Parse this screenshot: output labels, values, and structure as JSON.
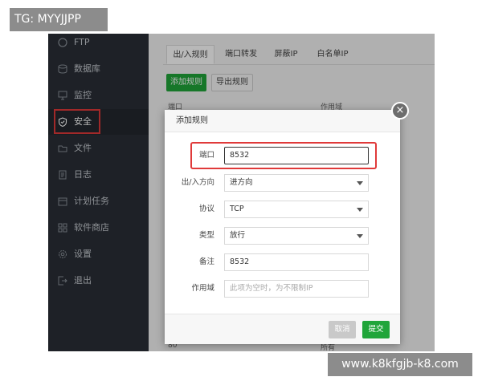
{
  "watermarks": {
    "top": "TG: MYYJJPP",
    "bottom": "www.k8kfgjb-k8.com"
  },
  "sidebar": {
    "items": [
      {
        "label": "FTP",
        "icon": "ftp-icon"
      },
      {
        "label": "数据库",
        "icon": "database-icon"
      },
      {
        "label": "监控",
        "icon": "monitor-icon"
      },
      {
        "label": "安全",
        "icon": "shield-icon",
        "active": true
      },
      {
        "label": "文件",
        "icon": "folder-icon"
      },
      {
        "label": "日志",
        "icon": "log-icon"
      },
      {
        "label": "计划任务",
        "icon": "calendar-icon"
      },
      {
        "label": "软件商店",
        "icon": "store-icon"
      },
      {
        "label": "设置",
        "icon": "gear-icon"
      },
      {
        "label": "退出",
        "icon": "exit-icon"
      }
    ]
  },
  "tabs": [
    "出/入规则",
    "端口转发",
    "屏蔽IP",
    "白名单IP"
  ],
  "toolbar": {
    "add_label": "添加规则",
    "export_label": "导出规则"
  },
  "table": {
    "col1": "端口",
    "col2": "作用域",
    "foot_col1": "80",
    "foot_col2": "所有"
  },
  "modal": {
    "title": "添加规则",
    "close_glyph": "×",
    "fields": {
      "port": {
        "label": "端口",
        "value": "8532"
      },
      "direction": {
        "label": "出/入方向",
        "value": "进方向"
      },
      "protocol": {
        "label": "协议",
        "value": "TCP"
      },
      "type": {
        "label": "类型",
        "value": "放行"
      },
      "remark": {
        "label": "备注",
        "value": "8532"
      },
      "scope": {
        "label": "作用域",
        "placeholder": "此项为空时，为不限制IP"
      }
    },
    "cancel_label": "取消",
    "submit_label": "提交"
  },
  "colors": {
    "accent_green": "#20a53a",
    "highlight_red": "#e03a3a",
    "sidebar_bg": "#2a2f36"
  }
}
